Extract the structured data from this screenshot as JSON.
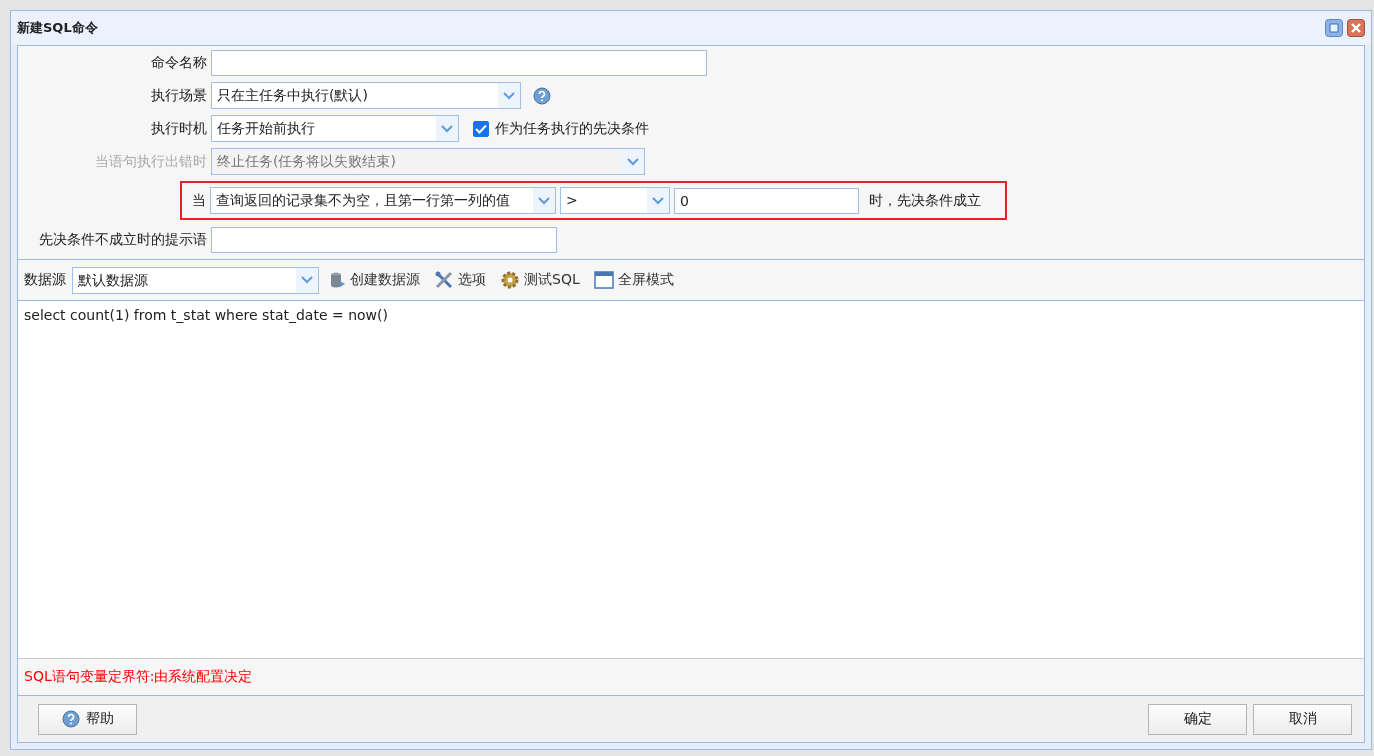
{
  "window": {
    "title": "新建SQL命令"
  },
  "form": {
    "rows": [
      {
        "kind": "input",
        "label": "命令名称"
      },
      {
        "kind": "select",
        "label": "执行场景",
        "value": "只在主任务中执行(默认)",
        "help": true
      },
      {
        "kind": "select",
        "label": "执行时机",
        "value": "任务开始前执行",
        "checkbox": {
          "label": "作为任务执行的先决条件",
          "checked": true
        }
      },
      {
        "kind": "select",
        "label": "当语句执行出错时",
        "value": "终止任务(任务将以失败结束)",
        "disabled": true
      },
      {
        "kind": "condition",
        "label": "当",
        "condition": "查询返回的记录集不为空，且第一行第一列的值",
        "operator": ">",
        "operand": "0",
        "suffix": "时，先决条件成立",
        "highlighted": true
      },
      {
        "kind": "input",
        "label": "先决条件不成立时的提示语"
      }
    ]
  },
  "toolbar": {
    "label": "数据源",
    "datasource": "默认数据源",
    "tools": [
      {
        "kind": "database",
        "label": "创建数据源"
      },
      {
        "kind": "tools",
        "label": "选项"
      },
      {
        "kind": "gear",
        "label": "测试SQL"
      },
      {
        "kind": "window",
        "label": "全屏模式"
      }
    ]
  },
  "editor": {
    "value": "select count(1) from t_stat where stat_date = now()"
  },
  "notice": "SQL语句变量定界符:由系统配置决定",
  "buttons": [
    {
      "kind": "help",
      "label": "帮助"
    },
    {
      "kind": "plain",
      "label": "确定"
    },
    {
      "kind": "plain",
      "label": "取消"
    }
  ]
}
